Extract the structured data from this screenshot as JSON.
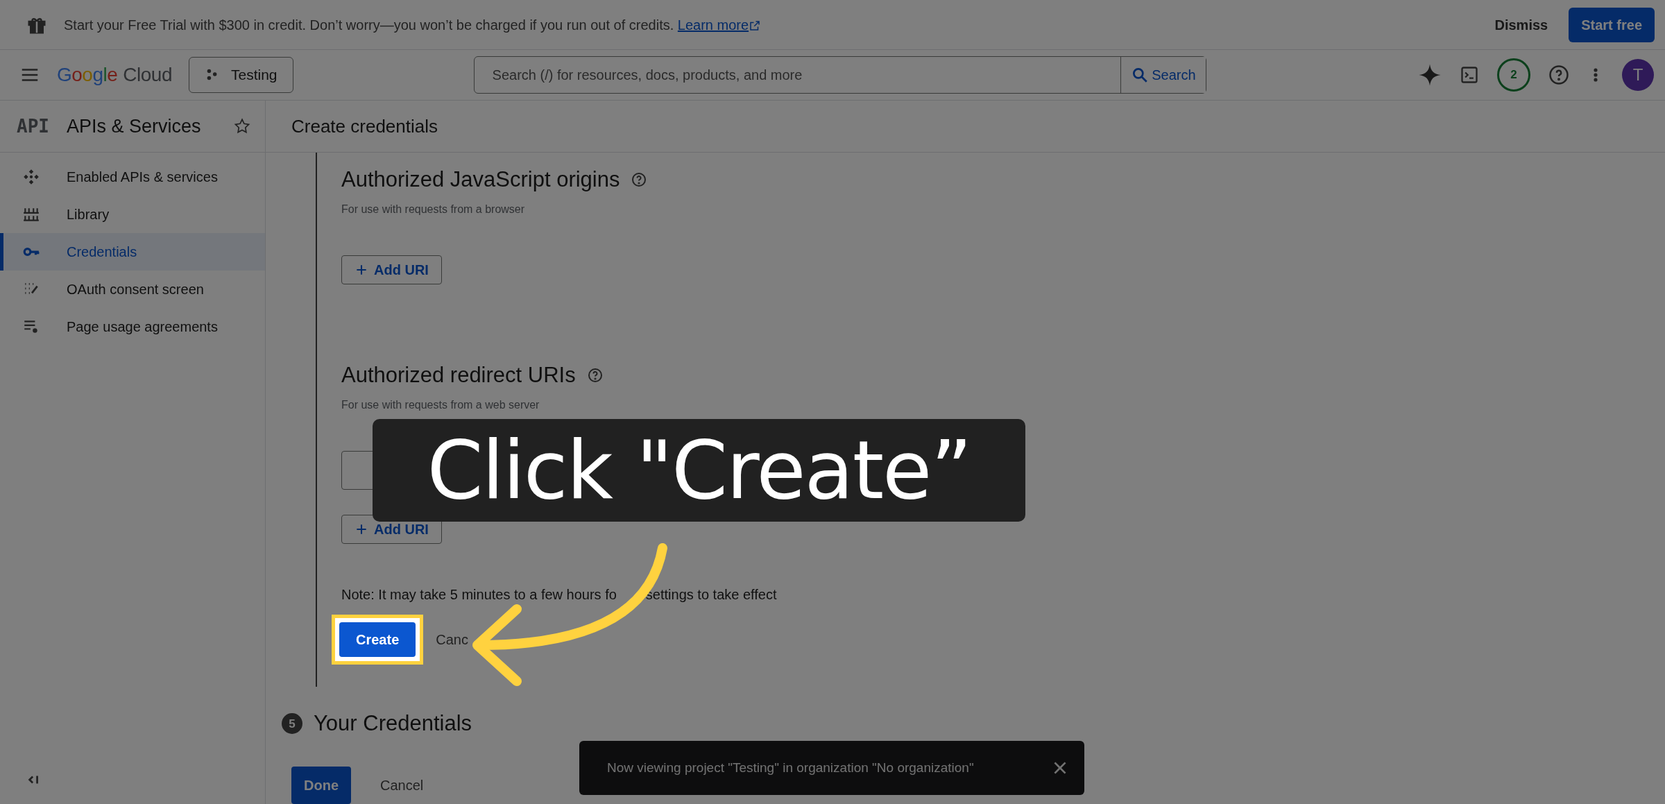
{
  "banner": {
    "text": "Start your Free Trial with $300 in credit. Don’t worry—you won’t be charged if you run out of credits.",
    "link": "Learn more",
    "dismiss": "Dismiss",
    "start": "Start free"
  },
  "header": {
    "product_brand": "Google",
    "product_name": "Cloud",
    "project": "Testing",
    "search_placeholder": "Search (/) for resources, docs, products, and more",
    "search_button": "Search",
    "notifications": "2",
    "avatar": "T"
  },
  "sidebar": {
    "logo": "API",
    "title": "APIs & Services",
    "items": [
      {
        "label": "Enabled APIs & services",
        "kind": "apis",
        "selected": false
      },
      {
        "label": "Library",
        "kind": "library",
        "selected": false
      },
      {
        "label": "Credentials",
        "kind": "key",
        "selected": true
      },
      {
        "label": "OAuth consent screen",
        "kind": "consent",
        "selected": false
      },
      {
        "label": "Page usage agreements",
        "kind": "agreements",
        "selected": false
      }
    ]
  },
  "page_title": "Create credentials",
  "sections": [
    {
      "kind": "plain",
      "title": "Authorized JavaScript origins",
      "subtitle": "For use with requests from a browser",
      "add_button": "Add URI"
    },
    {
      "kind": "field",
      "title": "Authorized redirect URIs",
      "subtitle": "For use with requests from a web server",
      "add_button": "Add URI"
    }
  ],
  "note_start": "Note: It may take 5 minutes to a few hours fo",
  "note_end": "settings to take effect",
  "create_button": "Create",
  "cancel_link": "Canc",
  "step": {
    "number": "5",
    "title": "Your Credentials"
  },
  "footer": {
    "done": "Done",
    "cancel": "Cancel"
  },
  "toast": {
    "text": "Now viewing project \"Testing\" in organization \"No organization\""
  },
  "callout": {
    "text": "Click \"Create”"
  }
}
